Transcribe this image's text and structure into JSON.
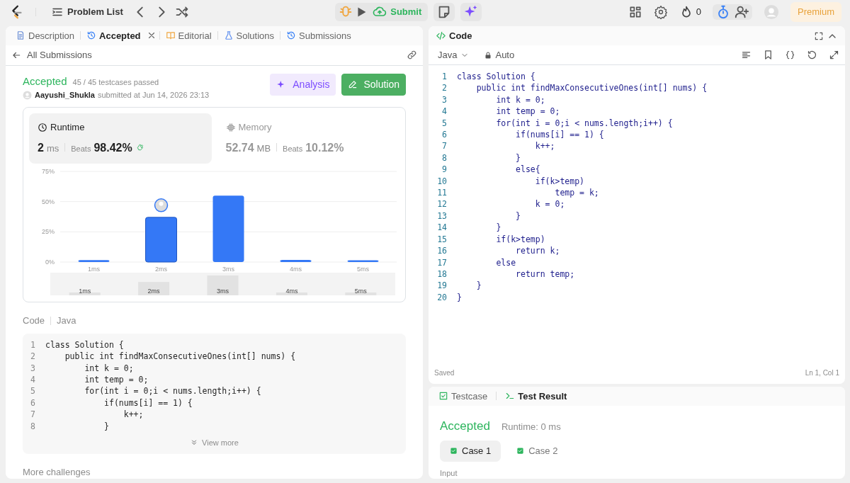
{
  "topbar": {
    "title": "Problem List",
    "submit": "Submit",
    "streak": "0",
    "premium": "Premium"
  },
  "left_tabs": [
    {
      "label": "Description",
      "selected": false,
      "closable": false,
      "kind": "doc"
    },
    {
      "label": "Accepted",
      "selected": true,
      "closable": true,
      "kind": "history"
    },
    {
      "label": "Editorial",
      "selected": false,
      "closable": false,
      "kind": "book"
    },
    {
      "label": "Solutions",
      "selected": false,
      "closable": false,
      "kind": "flask"
    },
    {
      "label": "Submissions",
      "selected": false,
      "closable": false,
      "kind": "history"
    }
  ],
  "back_link": "All Submissions",
  "submission": {
    "status": "Accepted",
    "testcases": "45 / 45 testcases passed",
    "user": "Aayushi_Shukla",
    "submitted": "submitted at Jun 14, 2026 23:13",
    "analysis": "Analysis",
    "solution": "Solution"
  },
  "metrics": [
    {
      "label": "Runtime",
      "value": "2",
      "unit": "ms",
      "beats_label": "Beats",
      "beats": "98.42%",
      "selected": true,
      "kind": "clock"
    },
    {
      "label": "Memory",
      "value": "52.74",
      "unit": "MB",
      "beats_label": "Beats",
      "beats": "10.12%",
      "selected": false,
      "kind": "chip"
    }
  ],
  "distribution": {
    "bars": [
      {
        "selected": false
      },
      {
        "selected": true
      },
      {
        "selected": false
      },
      {
        "selected": false
      },
      {
        "selected": false
      }
    ],
    "chart_data": {
      "type": "bar",
      "categories": [
        "1ms",
        "2ms",
        "3ms",
        "4ms",
        "5ms"
      ],
      "series": [
        {
          "color": "#3478f6",
          "values": [
            1.6,
            37,
            55,
            1.8,
            1.4
          ]
        }
      ],
      "ylim": [
        0,
        75
      ],
      "yticks": [
        {
          "value": 0,
          "label": "0%"
        },
        {
          "value": 25,
          "label": "25%"
        },
        {
          "value": 50,
          "label": "50%"
        },
        {
          "value": 75,
          "label": "75%"
        }
      ]
    },
    "overview_labels": [
      "1ms",
      "2ms",
      "3ms",
      "4ms",
      "5ms"
    ]
  },
  "code_preview": {
    "label": "Code",
    "language": "Java",
    "view_more": "View more",
    "lines": [
      {
        "n": "1",
        "text": "class Solution {"
      },
      {
        "n": "2",
        "text": "    public int findMaxConsecutiveOnes(int[] nums) {"
      },
      {
        "n": "3",
        "text": "        int k = 0;"
      },
      {
        "n": "4",
        "text": "        int temp = 0;"
      },
      {
        "n": "5",
        "text": "        for(int i = 0;i < nums.length;i++) {"
      },
      {
        "n": "6",
        "text": "            if(nums[i] == 1) {"
      },
      {
        "n": "7",
        "text": "                k++;"
      },
      {
        "n": "8",
        "text": "            }"
      }
    ]
  },
  "more_challenges": "More challenges",
  "editor": {
    "title": "Code",
    "language": "Java",
    "mode": "Auto",
    "status": "Saved",
    "cursor": "Ln 1, Col 1",
    "lines": [
      {
        "n": "1",
        "text": "class Solution {"
      },
      {
        "n": "2",
        "text": "    public int findMaxConsecutiveOnes(int[] nums) {"
      },
      {
        "n": "3",
        "text": "        int k = 0;"
      },
      {
        "n": "4",
        "text": "        int temp = 0;"
      },
      {
        "n": "5",
        "text": "        for(int i = 0;i < nums.length;i++) {"
      },
      {
        "n": "6",
        "text": "            if(nums[i] == 1) {"
      },
      {
        "n": "7",
        "text": "                k++;"
      },
      {
        "n": "8",
        "text": "            }"
      },
      {
        "n": "9",
        "text": "            else{"
      },
      {
        "n": "10",
        "text": "                if(k>temp)"
      },
      {
        "n": "11",
        "text": "                    temp = k;"
      },
      {
        "n": "12",
        "text": "                k = 0;"
      },
      {
        "n": "13",
        "text": "            }"
      },
      {
        "n": "14",
        "text": "        }"
      },
      {
        "n": "15",
        "text": "        if(k>temp)"
      },
      {
        "n": "16",
        "text": "            return k;"
      },
      {
        "n": "17",
        "text": "        else"
      },
      {
        "n": "18",
        "text": "            return temp;"
      },
      {
        "n": "19",
        "text": "    }"
      },
      {
        "n": "20",
        "text": "}"
      }
    ]
  },
  "result_tabs": [
    {
      "label": "Testcase",
      "selected": false,
      "kind": "check"
    },
    {
      "label": "Test Result",
      "selected": true,
      "kind": "terminal"
    }
  ],
  "result": {
    "status": "Accepted",
    "runtime": "Runtime: 0 ms",
    "input_label": "Input",
    "cases": [
      {
        "label": "Case 1",
        "selected": true,
        "passed": true
      },
      {
        "label": "Case 2",
        "selected": false,
        "passed": true
      }
    ]
  }
}
